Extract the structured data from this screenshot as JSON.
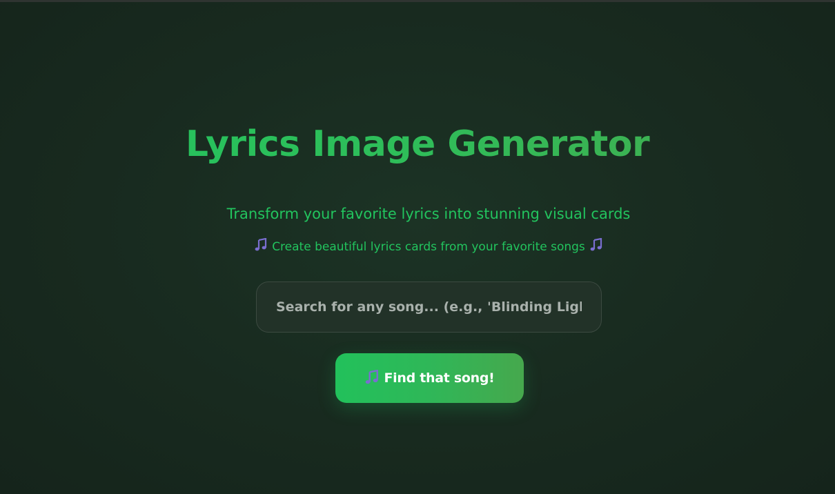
{
  "header": {
    "title": "Lyrics Image Generator",
    "subtitle": "Transform your favorite lyrics into stunning visual cards",
    "tagline": "Create beautiful lyrics cards from your favorite songs"
  },
  "search": {
    "placeholder": "Search for any song... (e.g., 'Blinding Lights The Weeknd')",
    "value": ""
  },
  "actions": {
    "find_label": "Find that song!"
  },
  "icons": {
    "note": "musical-notes-icon"
  },
  "colors": {
    "accent": "#22c45e",
    "note": "#7a6ed0",
    "background": "#182a1f"
  }
}
